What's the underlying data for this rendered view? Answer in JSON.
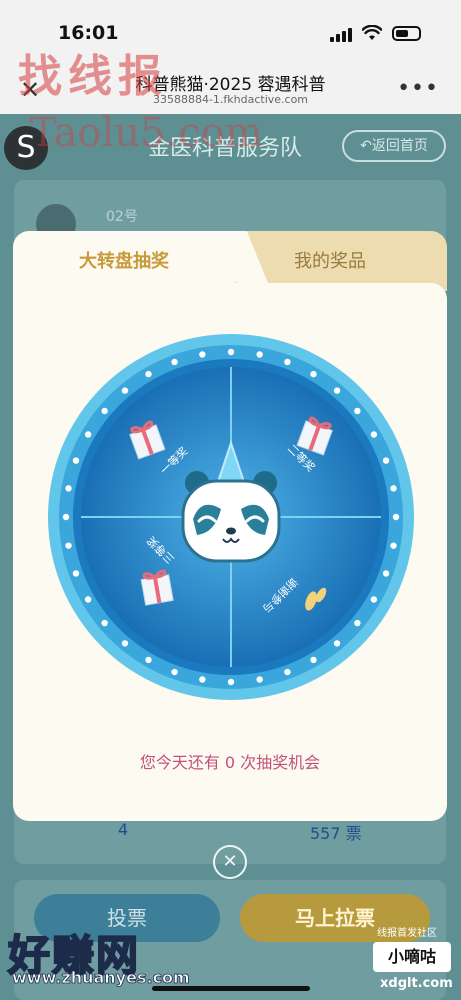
{
  "status_bar": {
    "time": "16:01"
  },
  "browser": {
    "title": "科普熊猫·2025 蓉遇科普",
    "url": "33588884-1.fkhdactive.com",
    "more_label": "•••"
  },
  "page": {
    "team_name": "金医科普服务队",
    "back_label": "返回首页",
    "entry_number": "02号",
    "stat_left": "4",
    "stat_right": "557 票",
    "vote_label": "投票",
    "pull_label": "马上拉票"
  },
  "modal": {
    "tabs": [
      {
        "label": "大转盘抽奖",
        "active": true
      },
      {
        "label": "我的奖品",
        "active": false
      }
    ],
    "wheel": {
      "prizes": [
        "一等奖",
        "二等奖",
        "三等奖",
        "谢谢参与"
      ]
    },
    "chances_text": "您今天还有 0 次抽奖机会"
  },
  "watermarks": {
    "top_cn": "找线报",
    "top_en": "Taolu5.com",
    "bottom_cn": "好赚网",
    "bottom_url": "www.zhuanyes.com",
    "corner_small": "线报首发社区",
    "corner_badge": "小嘀咕",
    "corner_url": "xdglt.com"
  },
  "colors": {
    "accent_gold": "#c89a3c",
    "chance_text": "#c0527a",
    "wheel_blue": "#1f86c7",
    "wheel_ring": "#62c6ea"
  }
}
